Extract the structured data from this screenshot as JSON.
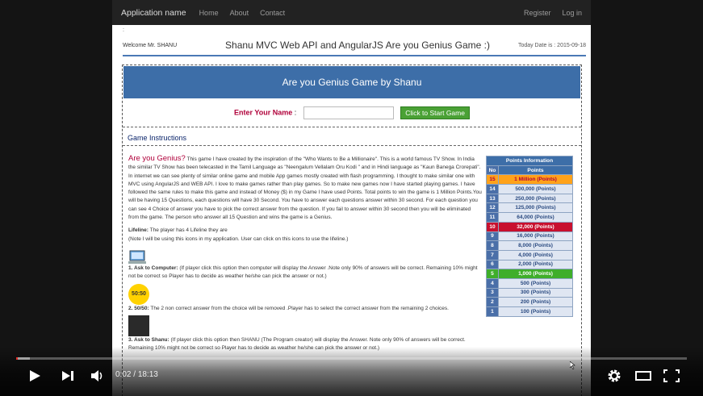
{
  "navbar": {
    "brand": "Application name",
    "links": [
      "Home",
      "About",
      "Contact"
    ],
    "right_links": [
      "Register",
      "Log in"
    ]
  },
  "crumb": ":",
  "header": {
    "welcome": "Welcome Mr. SHANU",
    "title": "Shanu MVC Web API and AngularJS Are you Genius Game :)",
    "today": "Today Date is : 2015-09-18"
  },
  "game": {
    "banner": "Are you Genius Game by Shanu",
    "name_label": "Enter Your Name",
    "name_colon": ":",
    "name_value": "",
    "start_button": "Click to Start Game",
    "instructions_title": "Game Instructions",
    "intro_heading": "Are you Genius?",
    "intro_text": "This game I have created by the inspiration of the \"Who Wants to Be a Millionaire\". This is a world famous TV Show. In India the similar TV Show has been telecasted in the Tamil Language as \"Neengalum Vellalam Oru Kodi \" and in Hindi language as \"Kaun Banega Crorepati\". In internet we can see plenty of similar online game and mobile App games mostly created with flash programming. I thought to make similar one with MVC using AngularJS and WEB API. I love to make games rather than play games. So to make new games now I have started playing games. I have followed the same rules to make this game and instead of Money ($) in my Game I have used Points. Total points to win the game is 1 Million Points.You will be having 15 Questions, each questions will have 30 Second. You have to answer each questions answer within 30 second. For each question you can see 4 Choice of answer you have to pick the correct answer from the question. If you fail to answer within 30 second then you will be eliminated from the game. The person who answer all 15 Question and wins the game is a Genius.",
    "lifeline_label": "Lifeline:",
    "lifeline_text": "The player has 4 Lifeline they are",
    "lifeline_note": "(Note I will be using this icons in my application. User can click on this icons to use the lifeline.)",
    "ask_computer_label": "1. Ask to Computer:",
    "ask_computer_text": "(If player click this option then computer will display the Answer .Note only 90% of answers will be correct. Remaining 10% might not be correct so Player has to decide as weather he/she can pick the answer or not.)",
    "fifty_icon_text": "50:50",
    "fifty_label": "2. 50/50:",
    "fifty_text": "The 2 non correct answer from the choice will be removed .Player has to select the correct answer from the remaining 2 choices.",
    "ask_shanu_label": "3. Ask to Shanu:",
    "ask_shanu_text": "(If player click this option then SHANU (The Program creator) will display the Answer. Note only 90% of answers will be correct. Remaining 10% might not be correct so Player has to decide as weather he/she can pick the answer or not.)"
  },
  "points": {
    "title": "Points Information",
    "col_no": "No",
    "col_points": "Points",
    "rows": [
      {
        "no": "15",
        "points": "1 Million (Points)",
        "style": "orange"
      },
      {
        "no": "14",
        "points": "500,000 (Points)",
        "style": "normal"
      },
      {
        "no": "13",
        "points": "250,000 (Points)",
        "style": "normal"
      },
      {
        "no": "12",
        "points": "125,000 (Points)",
        "style": "normal"
      },
      {
        "no": "11",
        "points": "64,000 (Points)",
        "style": "normal"
      },
      {
        "no": "10",
        "points": "32,000 (Points)",
        "style": "red"
      },
      {
        "no": "9",
        "points": "16,000 (Points)",
        "style": "normal"
      },
      {
        "no": "8",
        "points": "8,000 (Points)",
        "style": "normal"
      },
      {
        "no": "7",
        "points": "4,000 (Points)",
        "style": "normal"
      },
      {
        "no": "6",
        "points": "2,000 (Points)",
        "style": "normal"
      },
      {
        "no": "5",
        "points": "1,000 (Points)",
        "style": "green"
      },
      {
        "no": "4",
        "points": "500 (Points)",
        "style": "normal"
      },
      {
        "no": "3",
        "points": "300 (Points)",
        "style": "normal"
      },
      {
        "no": "2",
        "points": "200 (Points)",
        "style": "normal"
      },
      {
        "no": "1",
        "points": "100 (Points)",
        "style": "normal"
      }
    ]
  },
  "player": {
    "current_time": "0:02",
    "separator": "/",
    "duration": "18:13",
    "progress_fraction": 0.002,
    "buffered_fraction": 0.02,
    "play_icon": "play-icon",
    "next_icon": "next-icon",
    "volume_icon": "volume-icon",
    "settings_icon": "gear-icon",
    "theater_icon": "theater-mode-icon",
    "fullscreen_icon": "fullscreen-icon"
  },
  "colors": {
    "accent_blue": "#3d6ea8",
    "progress_red": "#e52d27",
    "start_button_green": "#4aa135",
    "label_crimson": "#b0003a"
  }
}
